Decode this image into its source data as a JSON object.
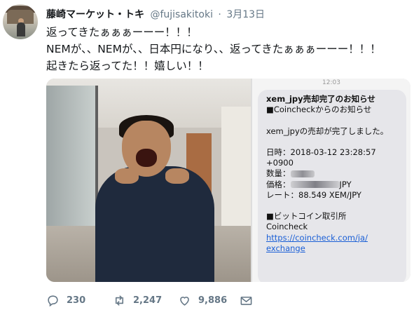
{
  "tweet": {
    "author_name": "藤崎マーケット・トキ",
    "handle": "@fujisakitoki",
    "separator": "·",
    "date": "3月13日",
    "lines": [
      "返ってきたぁぁぁーーー！！！",
      "NEMが、、NEMが、、日本円になり、、返ってきたぁぁぁーーー！！！",
      "起きたら返ってた！！嬉しい！！"
    ]
  },
  "screenshot": {
    "time_partial": "12:03",
    "title": "xem_jpy売却完了のお知らせ",
    "from": "■Coincheckからのお知らせ",
    "message": "xem_jpyの売却が完了しました。",
    "datetime_line": "日時：2018-03-12 23:28:57",
    "timezone": "+0900",
    "quantity_label": "数量：",
    "price_label": "価格：",
    "price_unit": "JPY",
    "rate_line": "レート：88.549 XEM/JPY",
    "exchange_name": "■ビットコイン取引所",
    "exchange_brand": "Coincheck",
    "link_line1": "https://coincheck.com/ja/",
    "link_line2": "exchange"
  },
  "actions": {
    "replies": "230",
    "retweets": "2,247",
    "likes": "9,886"
  },
  "icons": {
    "reply": "reply-icon",
    "retweet": "retweet-icon",
    "like": "heart-icon",
    "dm": "envelope-icon"
  },
  "colors": {
    "link": "#1a5fd6",
    "muted": "#657786"
  }
}
